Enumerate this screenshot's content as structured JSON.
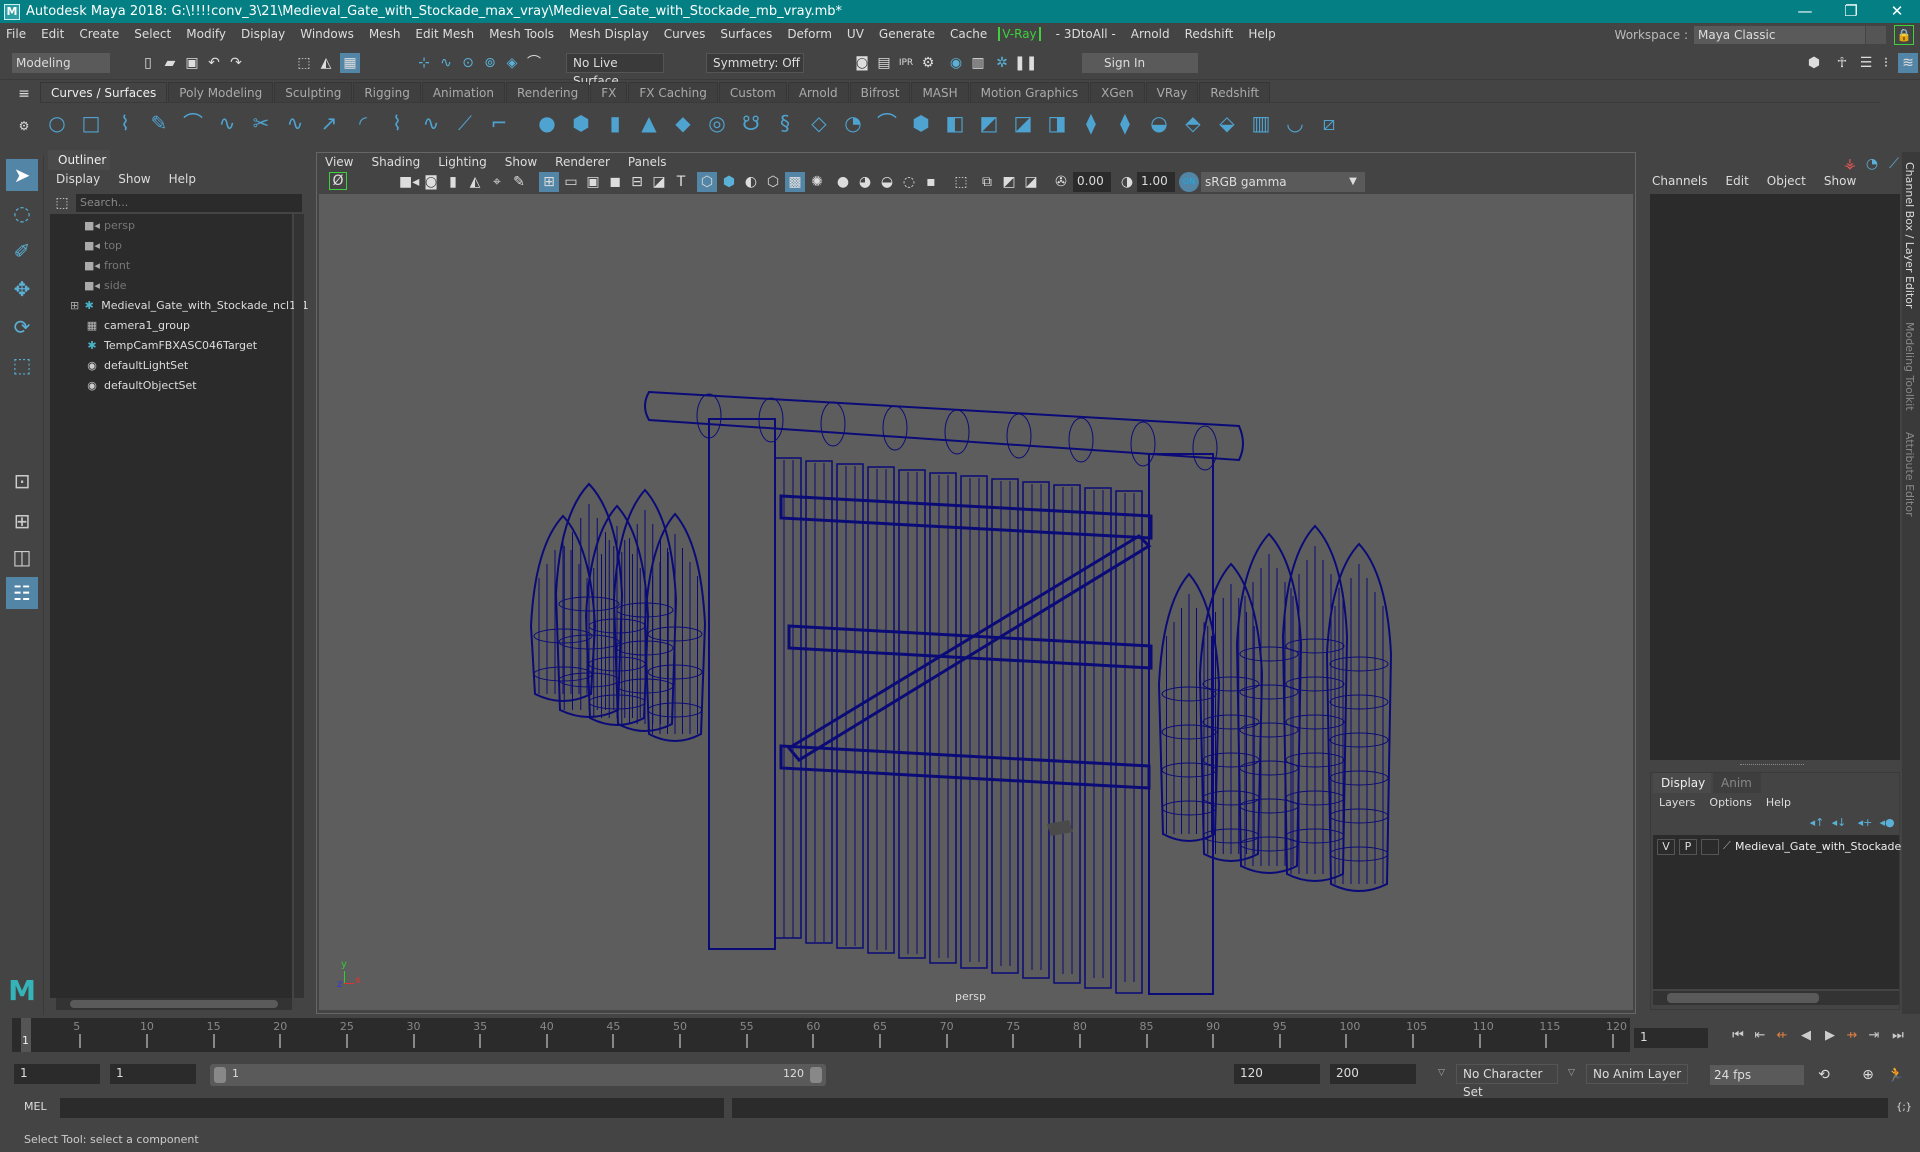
{
  "window": {
    "title": "Autodesk Maya 2018: G:\\!!!!conv_3\\21\\Medieval_Gate_with_Stockade_max_vray\\Medieval_Gate_with_Stockade_mb_vray.mb*",
    "logo": "M",
    "minimize": "—",
    "restore": "❐",
    "close": "✕"
  },
  "menubar": [
    "File",
    "Edit",
    "Create",
    "Select",
    "Modify",
    "Display",
    "Windows",
    "Mesh",
    "Edit Mesh",
    "Mesh Tools",
    "Mesh Display",
    "Curves",
    "Surfaces",
    "Deform",
    "UV",
    "Generate",
    "Cache",
    "V-Ray",
    "- 3DtoAll -",
    "Arnold",
    "Redshift",
    "Help"
  ],
  "workspace": {
    "label": "Workspace :",
    "value": "Maya Classic"
  },
  "statusline": {
    "mode": "Modeling",
    "live_surface": "No Live Surface",
    "symmetry": "Symmetry: Off",
    "sign_in": "Sign In"
  },
  "shelf": {
    "tabs": [
      "Curves / Surfaces",
      "Poly Modeling",
      "Sculpting",
      "Rigging",
      "Animation",
      "Rendering",
      "FX",
      "FX Caching",
      "Custom",
      "Arnold",
      "Bifrost",
      "MASH",
      "Motion Graphics",
      "XGen",
      "VRay",
      "Redshift"
    ],
    "active_tab": "Curves / Surfaces"
  },
  "outliner": {
    "title": "Outliner",
    "menu": [
      "Display",
      "Show",
      "Help"
    ],
    "search_placeholder": "Search...",
    "items": [
      {
        "label": "persp",
        "icon": "camera-icon",
        "dim": true
      },
      {
        "label": "top",
        "icon": "camera-icon",
        "dim": true
      },
      {
        "label": "front",
        "icon": "camera-icon",
        "dim": true
      },
      {
        "label": "side",
        "icon": "camera-icon",
        "dim": true
      },
      {
        "label": "Medieval_Gate_with_Stockade_ncl1_1",
        "icon": "transform-icon",
        "expandable": true
      },
      {
        "label": "camera1_group",
        "icon": "group-icon"
      },
      {
        "label": "TempCamFBXASC046Target",
        "icon": "transform-icon"
      },
      {
        "label": "defaultLightSet",
        "icon": "set-icon"
      },
      {
        "label": "defaultObjectSet",
        "icon": "set-icon"
      }
    ]
  },
  "viewport": {
    "menu": [
      "View",
      "Shading",
      "Lighting",
      "Show",
      "Renderer",
      "Panels"
    ],
    "exposure": "0.00",
    "gamma": "1.00",
    "color_space": "sRGB gamma",
    "camera_label": "persp",
    "axis": {
      "x": "x",
      "y": "y",
      "z": "z"
    },
    "wire_color": "#0b0b78"
  },
  "channel_box": {
    "menu": [
      "Channels",
      "Edit",
      "Object",
      "Show"
    ]
  },
  "layer_editor": {
    "tabs": [
      "Display",
      "Anim"
    ],
    "active_tab": "Display",
    "menu": [
      "Layers",
      "Options",
      "Help"
    ],
    "layers": [
      {
        "v": "V",
        "p": "P",
        "name": "Medieval_Gate_with_Stockade"
      }
    ]
  },
  "side_tabs": [
    "Channel Box / Layer Editor",
    "Modeling Toolkit",
    "Attribute Editor"
  ],
  "timeline": {
    "ticks": [
      5,
      10,
      15,
      20,
      25,
      30,
      35,
      40,
      45,
      50,
      55,
      60,
      65,
      70,
      75,
      80,
      85,
      90,
      95,
      100,
      105,
      110,
      115,
      120
    ],
    "start": 1,
    "end": 120,
    "current_frame": "1"
  },
  "range": {
    "start_field": "1",
    "playback_start": "1",
    "slider_start": "1",
    "slider_end": "120",
    "playback_end": "120",
    "end_field": "200",
    "character_set": "No Character Set",
    "anim_layer": "No Anim Layer",
    "fps": "24 fps"
  },
  "command_line": {
    "label": "MEL",
    "value": ""
  },
  "help_line": "Select Tool: select a component",
  "colors": {
    "title_bar": "#048085",
    "accent_blue": "#5285a6",
    "vray_green": "#3dd13d",
    "icon_blue": "#4fa3d0"
  }
}
